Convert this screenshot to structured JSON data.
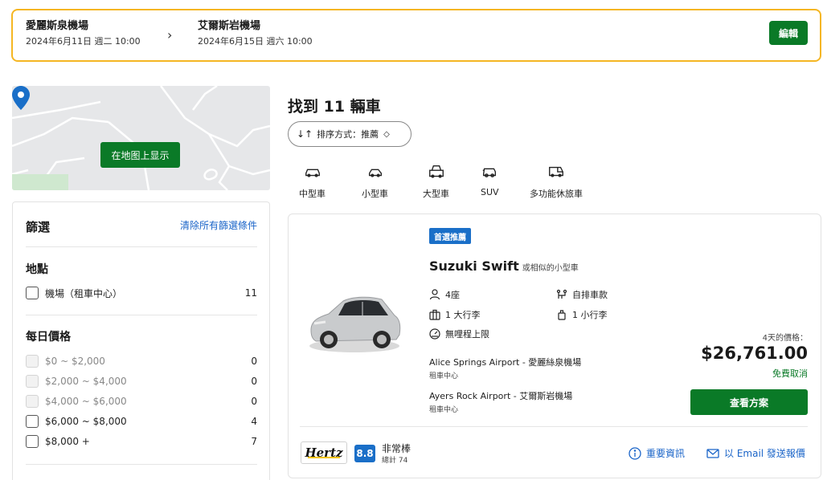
{
  "search": {
    "pickup": {
      "location": "愛麗斯泉機場",
      "datetime": "2024年6月11日 週二 10:00"
    },
    "dropoff": {
      "location": "艾爾斯岩機場",
      "datetime": "2024年6月15日 週六 10:00"
    },
    "arrow": "›",
    "edit_label": "編輯"
  },
  "map": {
    "button_label": "在地图上显示"
  },
  "filters": {
    "title": "篩選",
    "clear_all": "清除所有篩選條件",
    "location": {
      "title": "地點",
      "options": [
        {
          "label": "機場（租車中心）",
          "count": "11"
        }
      ]
    },
    "daily_price": {
      "title": "每日價格",
      "options": [
        {
          "label": "$0 ~ $2,000",
          "count": "0",
          "disabled": true
        },
        {
          "label": "$2,000 ~ $4,000",
          "count": "0",
          "disabled": true
        },
        {
          "label": "$4,000 ~ $6,000",
          "count": "0",
          "disabled": true
        },
        {
          "label": "$6,000 ~ $8,000",
          "count": "4",
          "disabled": false
        },
        {
          "label": "$8,000 +",
          "count": "7",
          "disabled": false
        }
      ]
    }
  },
  "results": {
    "title": "找到 11 輛車",
    "sort_label": "排序方式：推薦",
    "categories": [
      {
        "label": "中型車",
        "icon": "midsize-car-icon"
      },
      {
        "label": "小型車",
        "icon": "small-car-icon"
      },
      {
        "label": "大型車",
        "icon": "large-car-icon"
      },
      {
        "label": "SUV",
        "icon": "suv-icon"
      },
      {
        "label": "多功能休旅車",
        "icon": "van-icon"
      }
    ]
  },
  "car": {
    "badge": "首選推薦",
    "name": "Suzuki Swift",
    "name_suffix": "或相似的小型車",
    "specs": {
      "seats": "4座",
      "transmission": "自排車款",
      "large_bags": "1 大行李",
      "small_bags": "1 小行李",
      "mileage": "無哩程上限"
    },
    "pickup_location": "Alice Springs Airport - 愛麗絲泉機場",
    "pickup_type": "租車中心",
    "dropoff_location": "Ayers Rock Airport - 艾爾斯岩機場",
    "dropoff_type": "租車中心",
    "price_note": "4天的價格：",
    "price": "$26,761.00",
    "free_cancel": "免費取消",
    "deal_button": "查看方案",
    "supplier": "Hertz",
    "rating": "8.8",
    "rating_word": "非常棒",
    "rating_count": "總計 74",
    "important_info": "重要資訊",
    "email_quote": "以 Email 發送報價"
  },
  "colors": {
    "accent_green": "#0a7a27",
    "brand_blue": "#1a6fc8",
    "highlight_yellow": "#f5b623"
  }
}
